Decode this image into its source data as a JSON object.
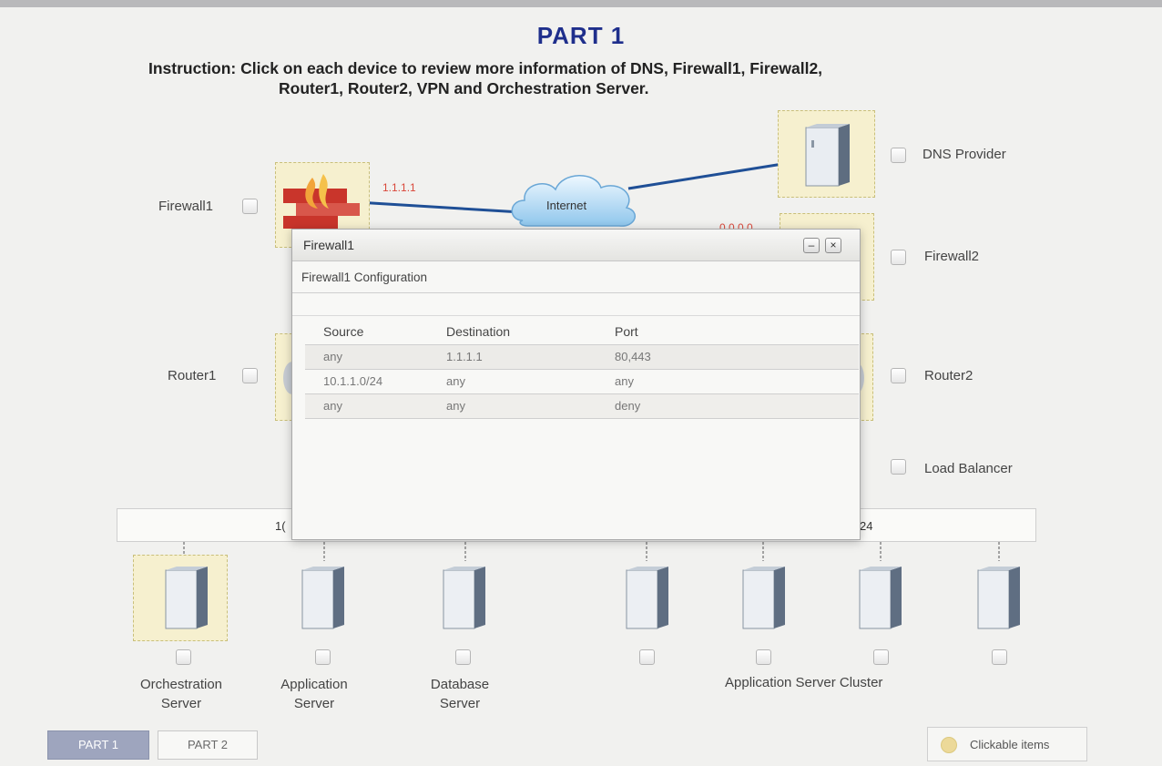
{
  "page": {
    "title": "PART 1",
    "instruction_line1": "Instruction: Click on each device to review more information of DNS, Firewall1, Firewall2,",
    "instruction_line2": "Router1, Router2, VPN and Orchestration Server."
  },
  "topology": {
    "internet_label": "Internet",
    "firewall1_ip": "1.1.1.1",
    "firewall2_ip_partial": "0.0.0.0",
    "devices": {
      "firewall1": "Firewall1",
      "router1": "Router1",
      "dns_provider": "DNS Provider",
      "firewall2": "Firewall2",
      "router2": "Router2",
      "load_balancer": "Load Balancer"
    },
    "subnet_left_partial": "1(",
    "subnet_right_partial": "24",
    "servers": {
      "orchestration": "Orchestration Server",
      "application": "Application Server",
      "database": "Database Server",
      "cluster": "Application Server Cluster"
    }
  },
  "dialog": {
    "title": "Firewall1",
    "subtitle": "Firewall1 Configuration",
    "minimize_glyph": "–",
    "close_glyph": "×",
    "columns": [
      "Source",
      "Destination",
      "Port"
    ],
    "rows": [
      [
        "any",
        "1.1.1.1",
        "80,443"
      ],
      [
        "10.1.1.0/24",
        "any",
        "any"
      ],
      [
        "any",
        "any",
        "deny"
      ]
    ]
  },
  "tabs": [
    {
      "label": "PART 1",
      "active": true
    },
    {
      "label": "PART 2",
      "active": false
    }
  ],
  "legend": {
    "label": "Clickable items"
  },
  "colors": {
    "title": "#1f2f8c",
    "clickable_fill": "#f6f0cf",
    "ip_text": "#d9473a",
    "link_line": "#1f4f96",
    "active_tab": "#9ea5be"
  }
}
